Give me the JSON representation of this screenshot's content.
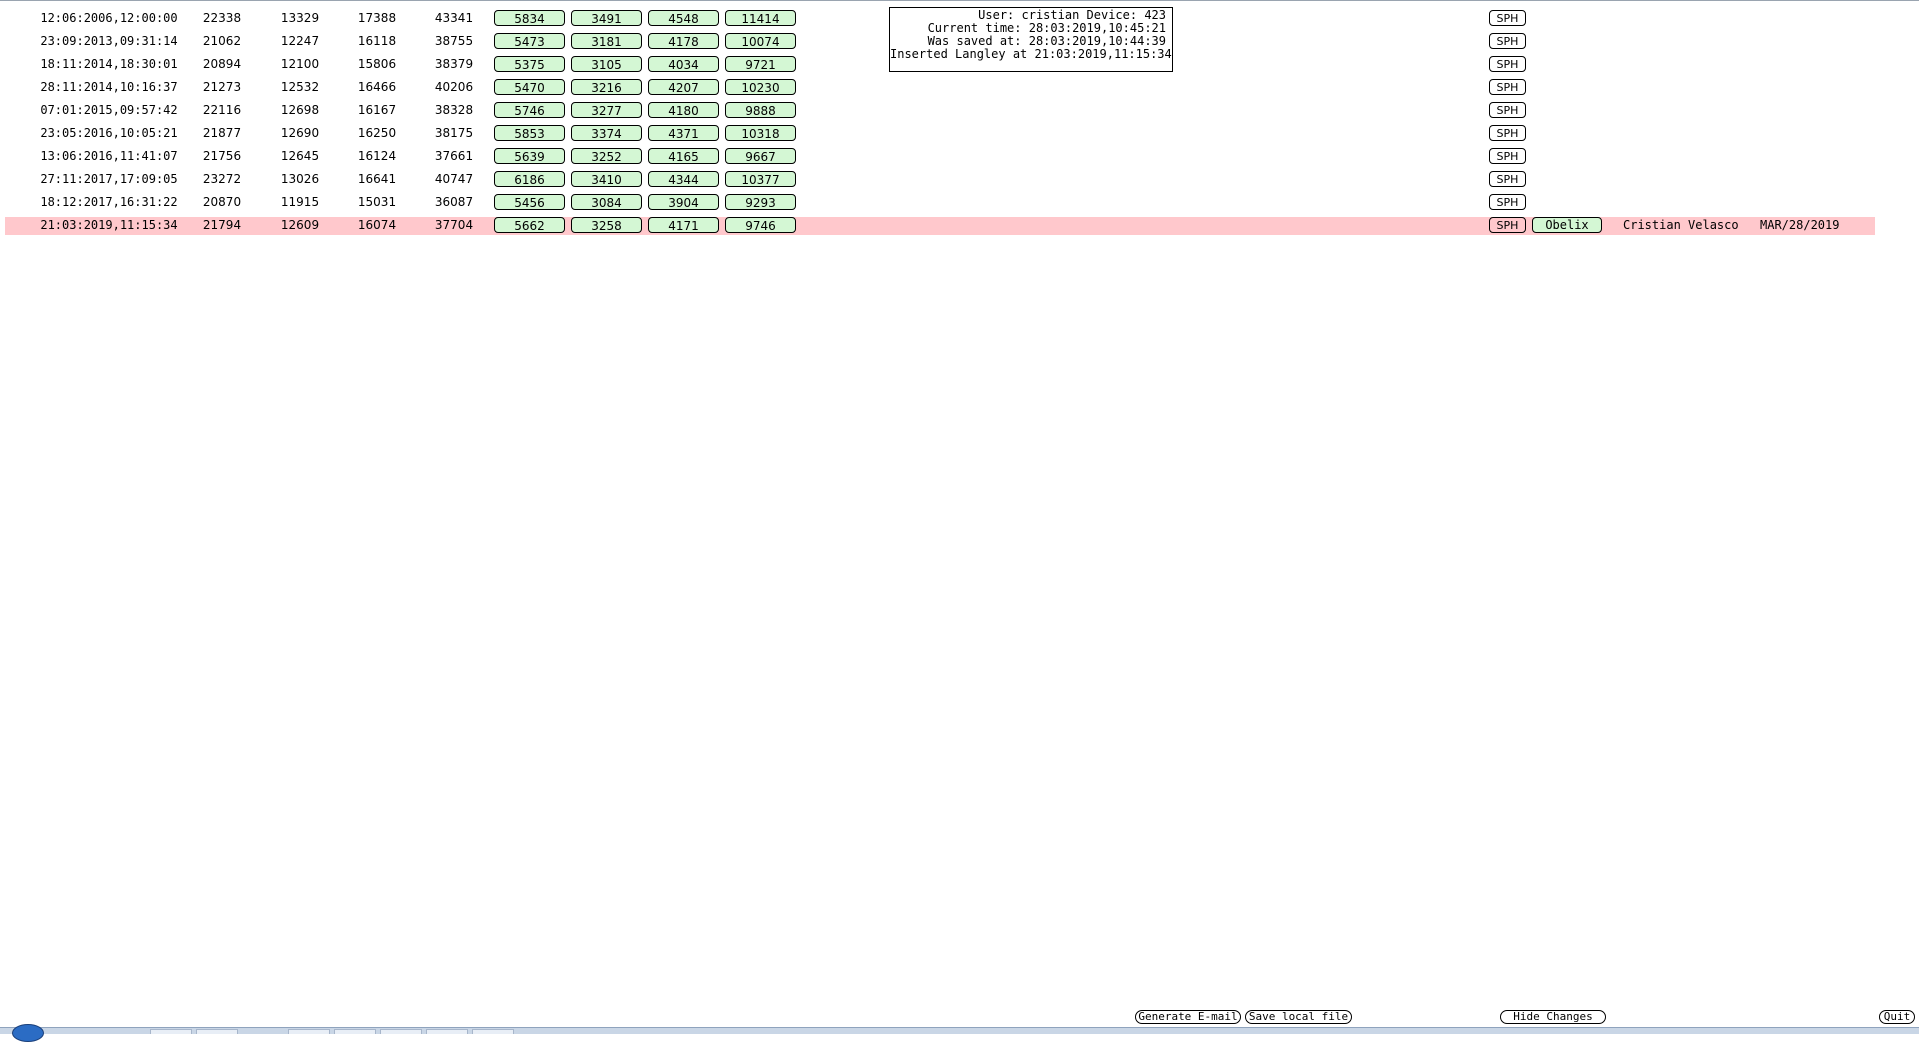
{
  "rows": [
    {
      "datetime": "12:06:2006,12:00:00",
      "v1": "22338",
      "v2": "13329",
      "v3": "17388",
      "v4": "43341",
      "b1": "5834",
      "b2": "3491",
      "b3": "4548",
      "b4": "11414",
      "sph": "SPH"
    },
    {
      "datetime": "23:09:2013,09:31:14",
      "v1": "21062",
      "v2": "12247",
      "v3": "16118",
      "v4": "38755",
      "b1": "5473",
      "b2": "3181",
      "b3": "4178",
      "b4": "10074",
      "sph": "SPH"
    },
    {
      "datetime": "18:11:2014,18:30:01",
      "v1": "20894",
      "v2": "12100",
      "v3": "15806",
      "v4": "38379",
      "b1": "5375",
      "b2": "3105",
      "b3": "4034",
      "b4": "9721",
      "sph": "SPH"
    },
    {
      "datetime": "28:11:2014,10:16:37",
      "v1": "21273",
      "v2": "12532",
      "v3": "16466",
      "v4": "40206",
      "b1": "5470",
      "b2": "3216",
      "b3": "4207",
      "b4": "10230",
      "sph": "SPH"
    },
    {
      "datetime": "07:01:2015,09:57:42",
      "v1": "22116",
      "v2": "12698",
      "v3": "16167",
      "v4": "38328",
      "b1": "5746",
      "b2": "3277",
      "b3": "4180",
      "b4": "9888",
      "sph": "SPH"
    },
    {
      "datetime": "23:05:2016,10:05:21",
      "v1": "21877",
      "v2": "12690",
      "v3": "16250",
      "v4": "38175",
      "b1": "5853",
      "b2": "3374",
      "b3": "4371",
      "b4": "10318",
      "sph": "SPH"
    },
    {
      "datetime": "13:06:2016,11:41:07",
      "v1": "21756",
      "v2": "12645",
      "v3": "16124",
      "v4": "37661",
      "b1": "5639",
      "b2": "3252",
      "b3": "4165",
      "b4": "9667",
      "sph": "SPH"
    },
    {
      "datetime": "27:11:2017,17:09:05",
      "v1": "23272",
      "v2": "13026",
      "v3": "16641",
      "v4": "40747",
      "b1": "6186",
      "b2": "3410",
      "b3": "4344",
      "b4": "10377",
      "sph": "SPH"
    },
    {
      "datetime": "18:12:2017,16:31:22",
      "v1": "20870",
      "v2": "11915",
      "v3": "15031",
      "v4": "36087",
      "b1": "5456",
      "b2": "3084",
      "b3": "3904",
      "b4": "9293",
      "sph": "SPH"
    },
    {
      "datetime": "21:03:2019,11:15:34",
      "v1": "21794",
      "v2": "12609",
      "v3": "16074",
      "v4": "37704",
      "b1": "5662",
      "b2": "3258",
      "b3": "4171",
      "b4": "9746",
      "sph": "SPH",
      "highlight": true,
      "device_button": "Obelix",
      "user_name": "Cristian Velasco",
      "date": "MAR/28/2019"
    }
  ],
  "info": {
    "line1": "User: cristian Device: 423",
    "line2": "Current time: 28:03:2019,10:45:21",
    "line3": "Was saved at: 28:03:2019,10:44:39",
    "line4": "Inserted Langley at 21:03:2019,11:15:34"
  },
  "footer": {
    "generate_email": "Generate E-mail",
    "save_local": "Save local file",
    "hide_changes": "Hide Changes",
    "quit": "Quit"
  },
  "colors": {
    "button_green": "#d4f7d4",
    "highlight_row": "#ffc8cc"
  }
}
